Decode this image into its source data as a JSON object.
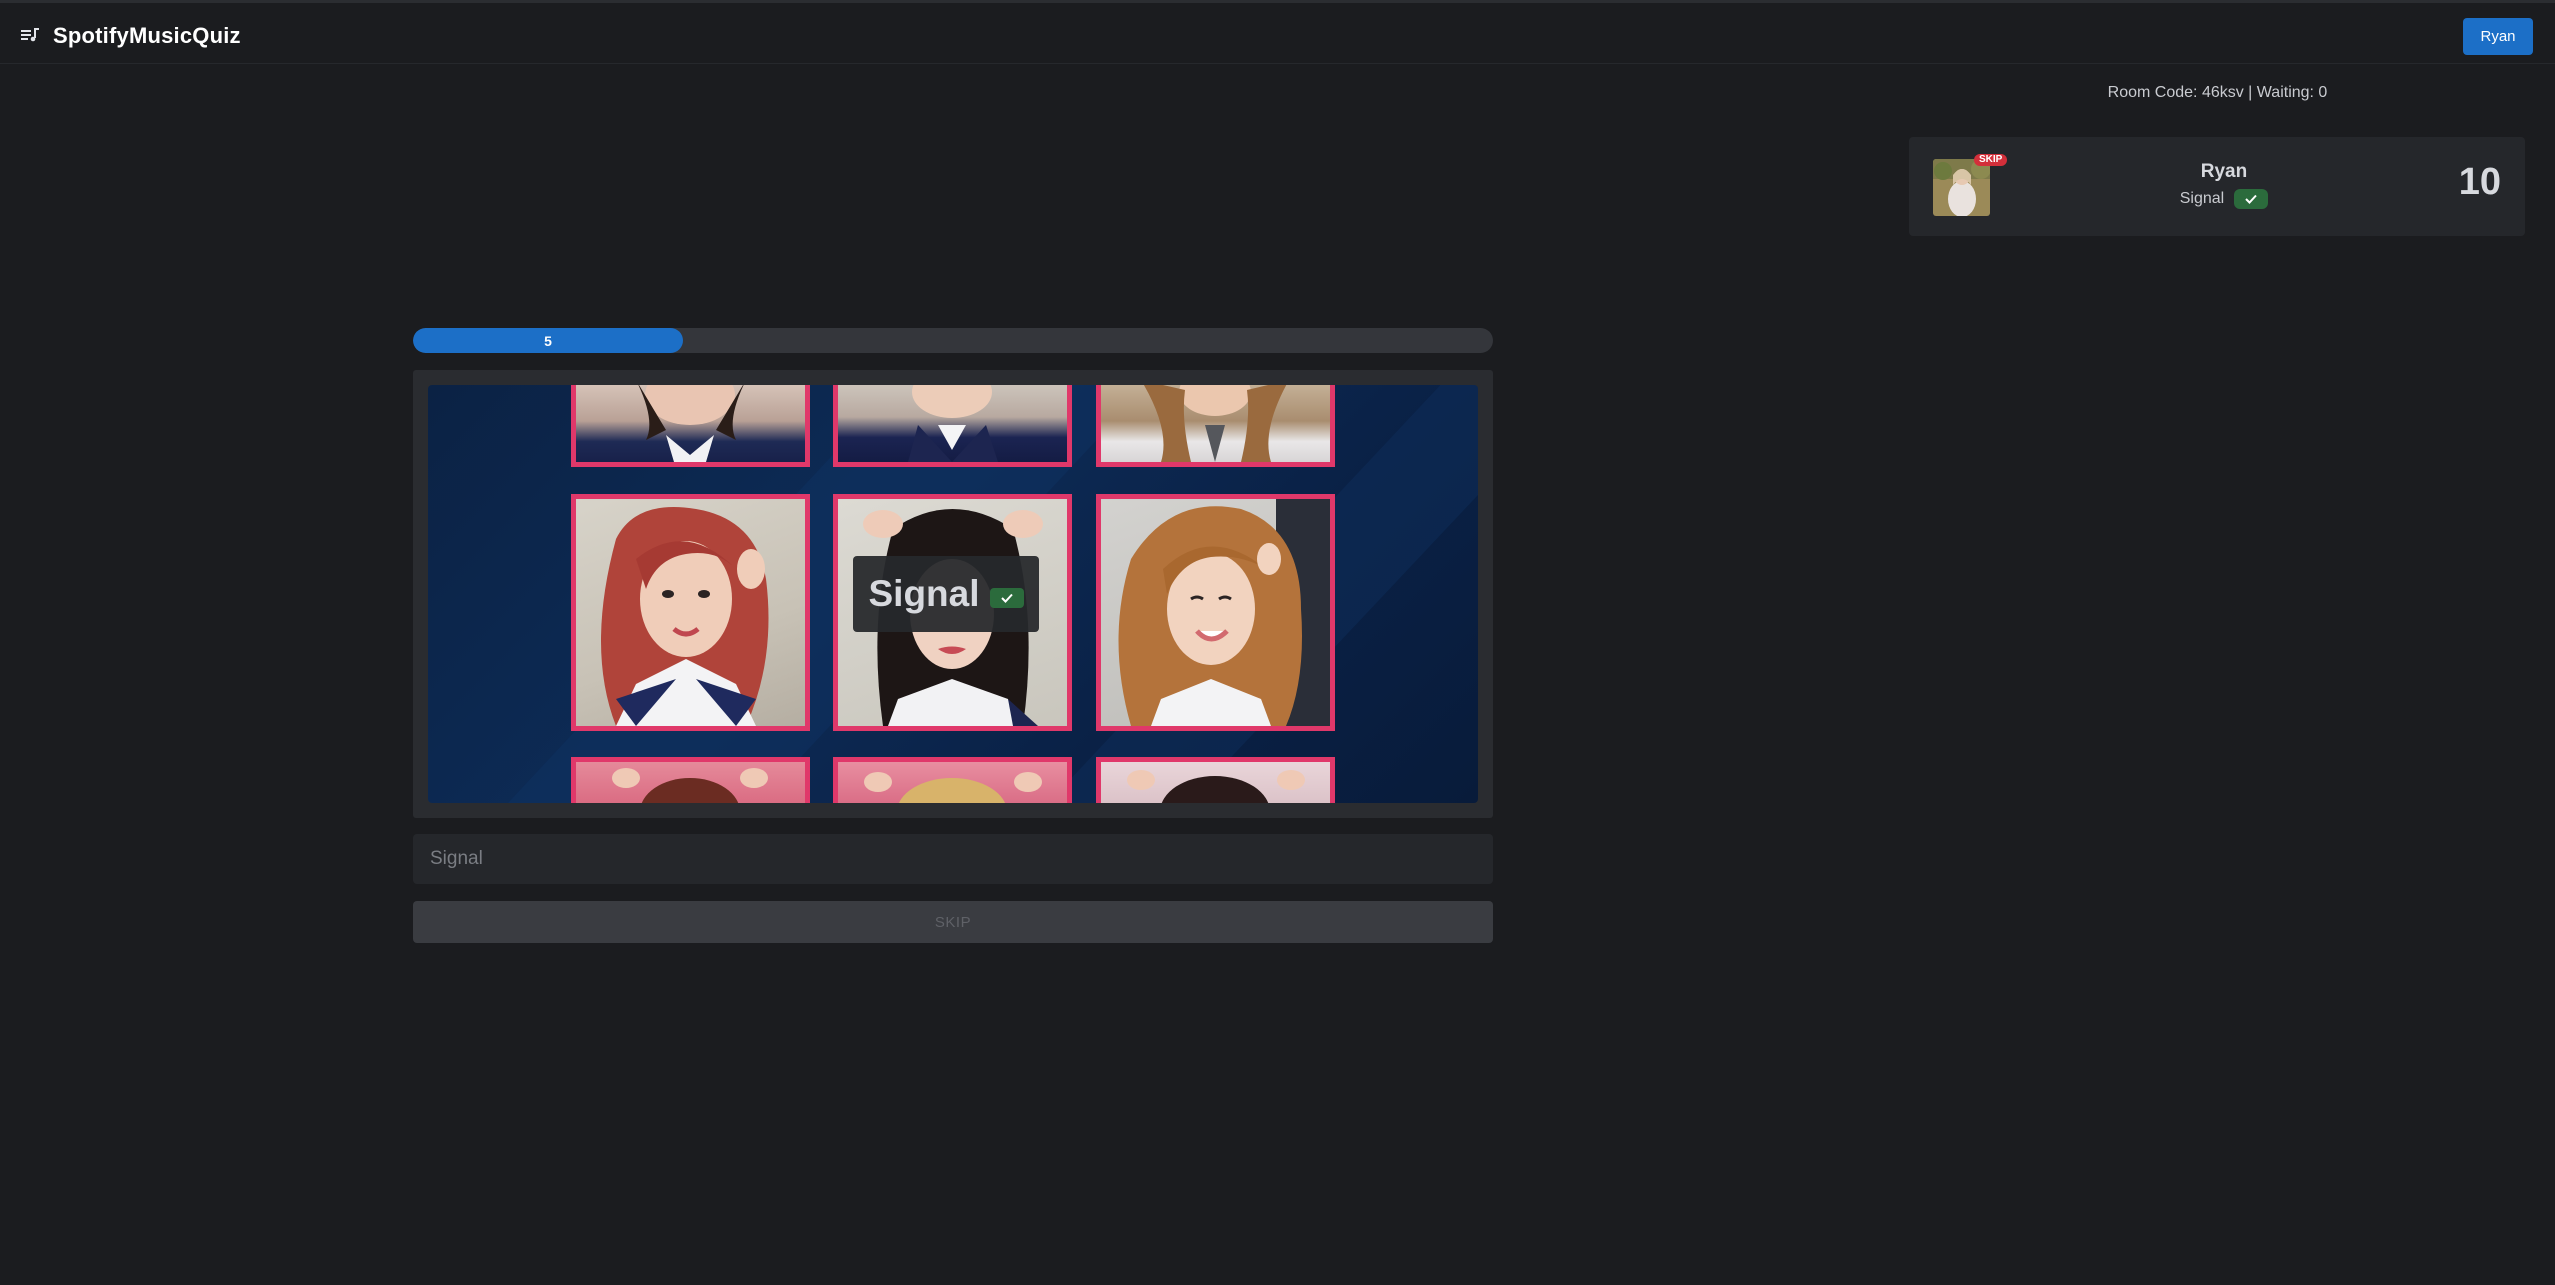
{
  "app": {
    "title": "SpotifyMusicQuiz"
  },
  "header": {
    "user_button": "Ryan",
    "menu_icon": "queue-music-icon"
  },
  "room": {
    "info": "Room Code: 46ksv | Waiting: 0"
  },
  "players": [
    {
      "name": "Ryan",
      "answer": "Signal",
      "status_badge": "SKIP",
      "score": "10",
      "correct": true
    }
  ],
  "round": {
    "timer_label": "5",
    "timer_progress_fraction": 0.25
  },
  "media": {
    "revealed_answer": "Signal",
    "correct": true
  },
  "guess": {
    "value": "",
    "placeholder": "Signal"
  },
  "actions": {
    "skip_label": "SKIP"
  },
  "colors": {
    "accent": "#1c6fc7",
    "background": "#1b1c1f",
    "success": "#2b6b3c",
    "danger": "#d32f3a",
    "photo_frame": "#e0386a"
  }
}
